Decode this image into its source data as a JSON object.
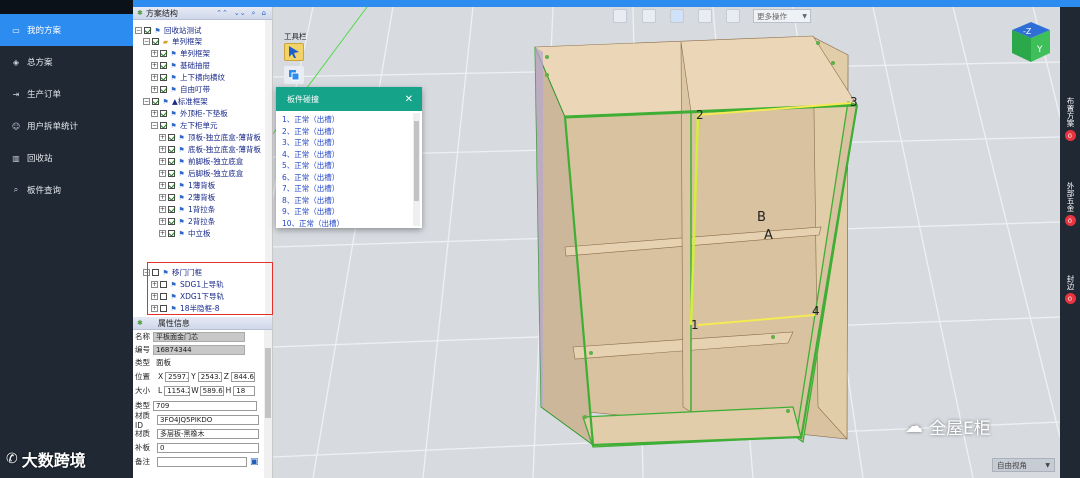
{
  "nav": {
    "items": [
      {
        "label": "我的方案",
        "icon": "folder-icon",
        "active": true
      },
      {
        "label": "总方案",
        "icon": "layers-icon",
        "active": false
      },
      {
        "label": "生产订单",
        "icon": "export-icon",
        "active": false
      },
      {
        "label": "用户拆单统计",
        "icon": "user-icon",
        "active": false
      },
      {
        "label": "回收站",
        "icon": "trash-icon",
        "active": false
      },
      {
        "label": "板件查询",
        "icon": "search-icon",
        "active": false
      }
    ]
  },
  "tree_panel": {
    "title": "方案结构",
    "tools": [
      "▲▲",
      "▼▼",
      "🔍",
      "⌂"
    ],
    "rows": [
      {
        "label": "回收站测试",
        "checked": true,
        "expand": "−"
      },
      {
        "label": "单列框架",
        "checked": true,
        "expand": "−"
      },
      {
        "label": "单列框架",
        "checked": true,
        "expand": "+"
      },
      {
        "label": "基础抽屉",
        "checked": true,
        "expand": "+"
      },
      {
        "label": "上下横向横纹",
        "checked": true,
        "expand": "+"
      },
      {
        "label": "自由叮带",
        "checked": true,
        "expand": "+"
      },
      {
        "label": "▲标准框架",
        "checked": true,
        "expand": "−"
      },
      {
        "label": "外顶柜-下垫板",
        "checked": true,
        "expand": "+"
      },
      {
        "label": "左下柜单元",
        "checked": true,
        "expand": "−"
      },
      {
        "label": "顶板-独立底盒-薄背板",
        "checked": true,
        "expand": "+"
      },
      {
        "label": "底板-独立底盒-薄背板",
        "checked": true,
        "expand": "+"
      },
      {
        "label": "前脚板-独立底盒",
        "checked": true,
        "expand": "+"
      },
      {
        "label": "后脚板-独立底盒",
        "checked": true,
        "expand": "+"
      },
      {
        "label": "1薄背板",
        "checked": true,
        "expand": "+"
      },
      {
        "label": "2薄背板",
        "checked": true,
        "expand": "+"
      },
      {
        "label": "1背拉条",
        "checked": true,
        "expand": "+"
      },
      {
        "label": "2背拉条",
        "checked": true,
        "expand": "+"
      },
      {
        "label": "中立板",
        "checked": true,
        "expand": "+"
      },
      {
        "label": "移门门框",
        "checked": false,
        "expand": "−"
      },
      {
        "label": "SDG1上导轨",
        "checked": false,
        "expand": "+"
      },
      {
        "label": "XDG1下导轨",
        "checked": false,
        "expand": "+"
      },
      {
        "label": "18半隐框-8",
        "checked": false,
        "expand": "+"
      },
      {
        "label": "18半隐框-8",
        "checked": false,
        "expand": "+"
      }
    ]
  },
  "prop_panel": {
    "title": "属性信息",
    "name_label": "名称",
    "name_value": "平板面金门芯",
    "code_label": "编号",
    "code_value": "16874344",
    "type_label": "类型",
    "type_value": "面板",
    "pos_label": "位置",
    "pos_x_label": "X",
    "pos_x": "2597.0",
    "pos_y_label": "Y",
    "pos_y": "2543.1",
    "pos_z_label": "Z",
    "pos_z": "844.6",
    "size_label": "大小",
    "size_l_label": "L",
    "size_l": "1154.2",
    "size_w_label": "W",
    "size_w": "589.6",
    "size_h_label": "H",
    "size_h": "18",
    "kind_label": "类型",
    "kind_value": "709",
    "matid_label": "材质ID",
    "matid_value": "3FO4JQ5PIKDO",
    "mat_label": "材质",
    "mat_value": "多层板-黑橡木",
    "patch_label": "补板",
    "patch_value": "0",
    "note_label": "备注",
    "note_value": ""
  },
  "viewport": {
    "toolbox_label": "工具栏",
    "more_ops": "更多操作",
    "view_select": "自由视角",
    "labels": {
      "n1": "1",
      "n2": "2",
      "n3": "3",
      "n4": "4",
      "a": "A",
      "b": "B"
    },
    "cube": {
      "top": "-Z",
      "front": "Y"
    }
  },
  "dialog": {
    "title": "板件碰撞",
    "items": [
      "1、正常（出槽）",
      "2、正常（出槽）",
      "3、正常（出槽）",
      "4、正常（出槽）",
      "5、正常（出槽）",
      "6、正常（出槽）",
      "7、正常（出槽）",
      "8、正常（出槽）",
      "9、正常（出槽）",
      "10、正常（出槽）"
    ]
  },
  "rightbar": {
    "items": [
      {
        "label": "布置方案",
        "count": "0"
      },
      {
        "label": "外部五金",
        "count": "0"
      },
      {
        "label": "封边",
        "count": "0"
      }
    ]
  },
  "watermark": {
    "left": "大数跨境",
    "right": "全屋E柜"
  },
  "colors": {
    "nav_bg": "#1f2833",
    "accent": "#2d8cf0",
    "dialog_head": "#15a38a",
    "highlight": "#e0322b",
    "board": "#e8d2b4",
    "board_edge": "#3fae35"
  }
}
